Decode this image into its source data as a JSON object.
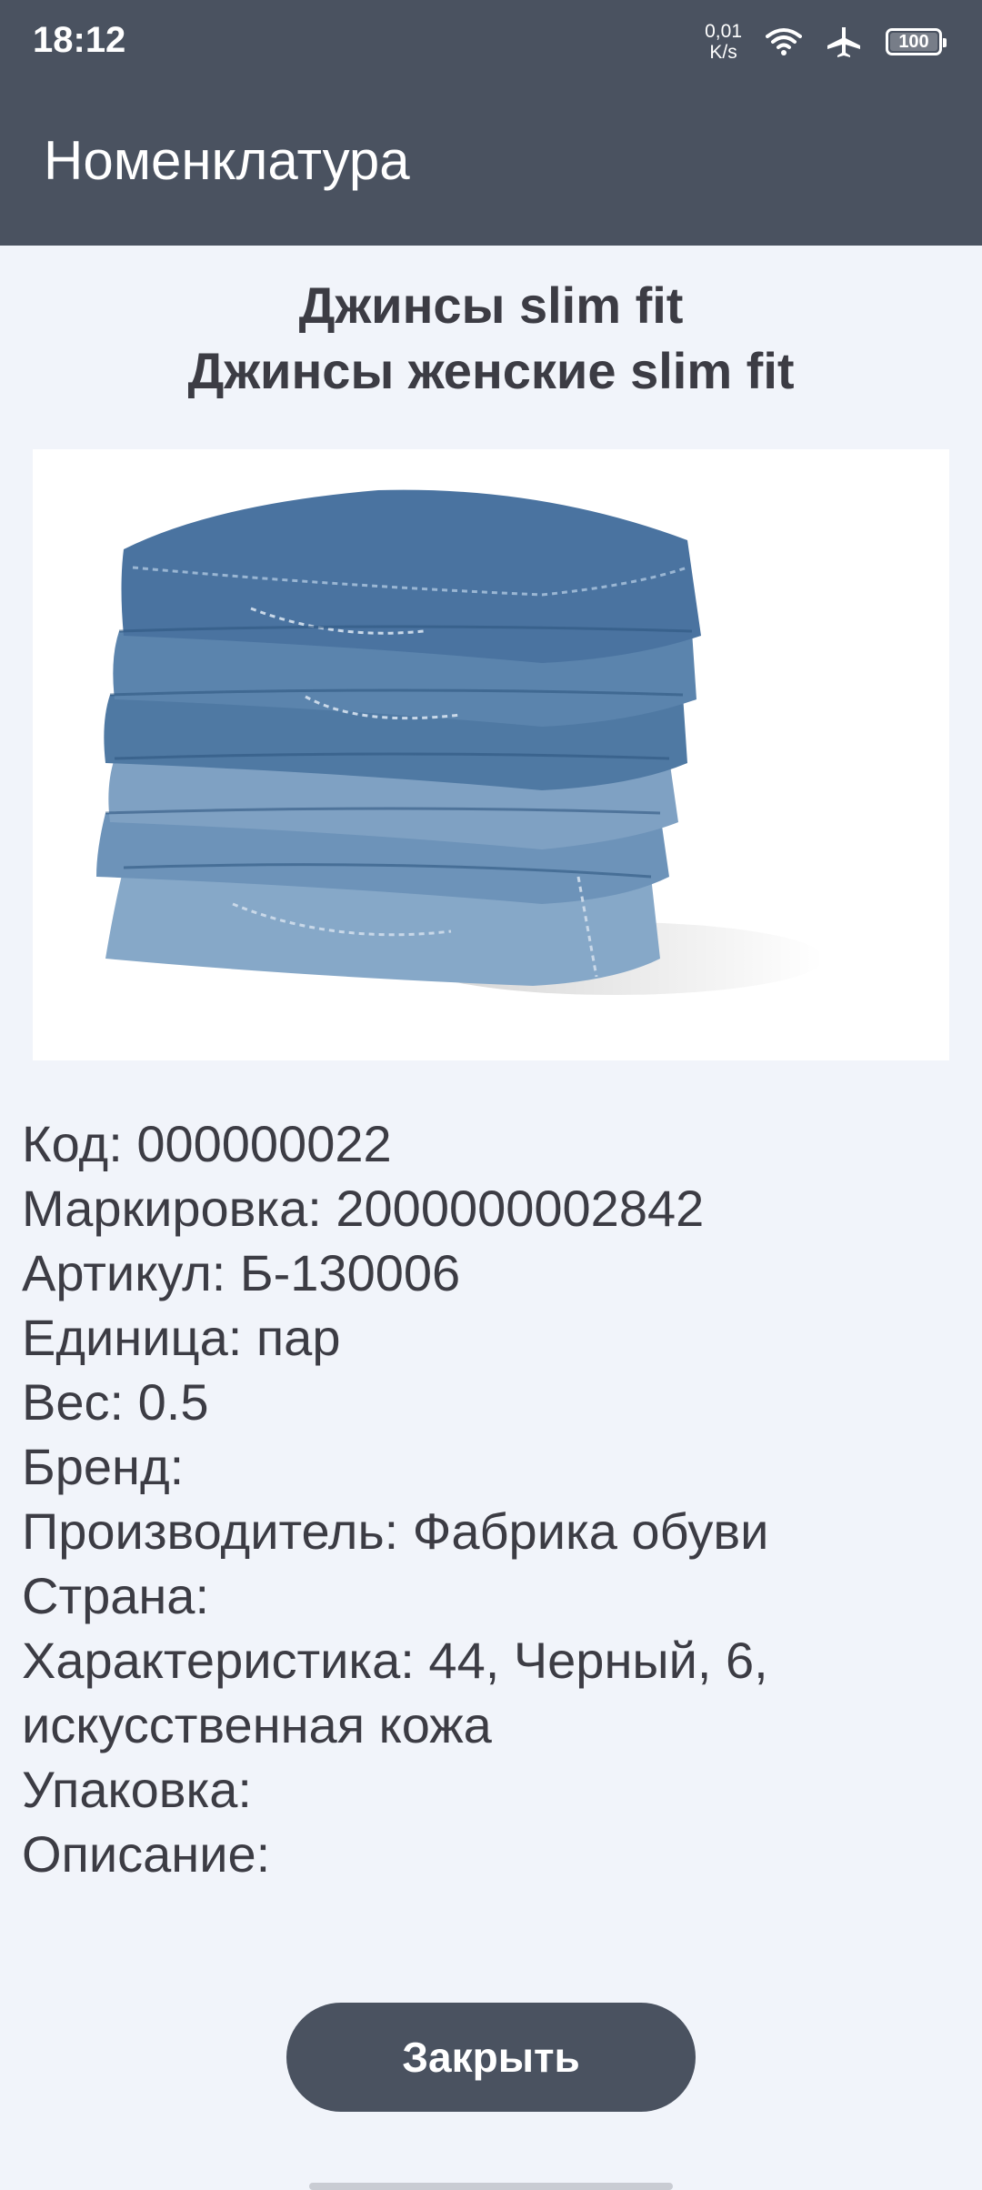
{
  "status_bar": {
    "time": "18:12",
    "net_speed_value": "0,01",
    "net_speed_unit": "K/s",
    "battery": "100",
    "battery_level": 1.0,
    "icons": [
      "wifi-icon",
      "airplane-mode-icon",
      "battery-icon"
    ]
  },
  "app_bar": {
    "title": "Номенклатура"
  },
  "product": {
    "title_line1": "Джинсы slim fit",
    "title_line2": "Джинсы женские slim fit",
    "image_subject": "stack of folded blue jeans"
  },
  "details": {
    "code": "Код: 000000022",
    "marking": "Маркировка: 2000000002842",
    "article": "Артикул: Б-130006",
    "unit": "Единица: пар",
    "weight": "Вес: 0.5",
    "brand": "Бренд:",
    "manufacturer": "Производитель: Фабрика обуви",
    "country": "Страна:",
    "characteristic": "Характеристика: 44, Черный, 6, искусственная кожа",
    "packaging": "Упаковка:",
    "description": "Описание:"
  },
  "actions": {
    "close_label": "Закрыть"
  },
  "colors": {
    "primary": "#4a5260",
    "background": "#f1f4fa",
    "text": "#3c3c44",
    "denim_dark": "#3f6890",
    "denim_mid": "#5b84ad",
    "denim_light": "#86a8c8"
  }
}
